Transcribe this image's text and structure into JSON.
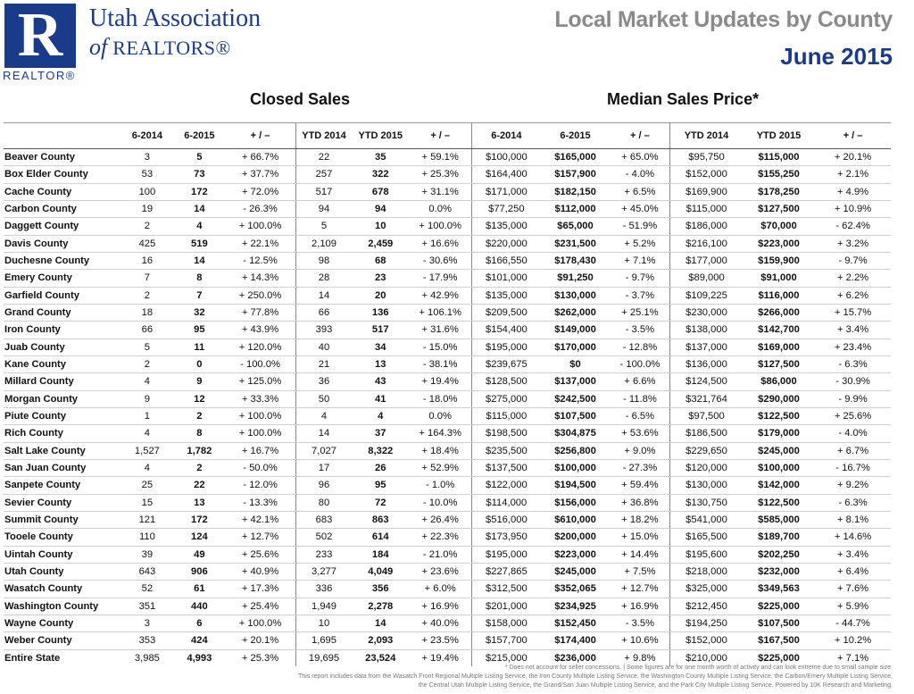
{
  "logo": {
    "letter": "R",
    "word": "REALTOR®"
  },
  "org": {
    "line1": "Utah Association",
    "of": "of",
    "line2": "REALTORS®"
  },
  "header": {
    "title": "Local Market Updates by County",
    "date": "June 2015"
  },
  "sections": {
    "closed": "Closed Sales",
    "median": "Median Sales Price*"
  },
  "columns": [
    "6-2014",
    "6-2015",
    "+ / –",
    "YTD 2014",
    "YTD 2015",
    "+ / –",
    "6-2014",
    "6-2015",
    "+ / –",
    "YTD 2014",
    "YTD 2015",
    "+ / –"
  ],
  "rows": [
    [
      "Beaver County",
      "3",
      "5",
      "+ 66.7%",
      "22",
      "35",
      "+ 59.1%",
      "$100,000",
      "$165,000",
      "+ 65.0%",
      "$95,750",
      "$115,000",
      "+ 20.1%"
    ],
    [
      "Box Elder County",
      "53",
      "73",
      "+ 37.7%",
      "257",
      "322",
      "+ 25.3%",
      "$164,400",
      "$157,900",
      "- 4.0%",
      "$152,000",
      "$155,250",
      "+ 2.1%"
    ],
    [
      "Cache County",
      "100",
      "172",
      "+ 72.0%",
      "517",
      "678",
      "+ 31.1%",
      "$171,000",
      "$182,150",
      "+ 6.5%",
      "$169,900",
      "$178,250",
      "+ 4.9%"
    ],
    [
      "Carbon County",
      "19",
      "14",
      "- 26.3%",
      "94",
      "94",
      "0.0%",
      "$77,250",
      "$112,000",
      "+ 45.0%",
      "$115,000",
      "$127,500",
      "+ 10.9%"
    ],
    [
      "Daggett County",
      "2",
      "4",
      "+ 100.0%",
      "5",
      "10",
      "+ 100.0%",
      "$135,000",
      "$65,000",
      "- 51.9%",
      "$186,000",
      "$70,000",
      "- 62.4%"
    ],
    [
      "Davis County",
      "425",
      "519",
      "+ 22.1%",
      "2,109",
      "2,459",
      "+ 16.6%",
      "$220,000",
      "$231,500",
      "+ 5.2%",
      "$216,100",
      "$223,000",
      "+ 3.2%"
    ],
    [
      "Duchesne County",
      "16",
      "14",
      "- 12.5%",
      "98",
      "68",
      "- 30.6%",
      "$166,550",
      "$178,430",
      "+ 7.1%",
      "$177,000",
      "$159,900",
      "- 9.7%"
    ],
    [
      "Emery County",
      "7",
      "8",
      "+ 14.3%",
      "28",
      "23",
      "- 17.9%",
      "$101,000",
      "$91,250",
      "- 9.7%",
      "$89,000",
      "$91,000",
      "+ 2.2%"
    ],
    [
      "Garfield County",
      "2",
      "7",
      "+ 250.0%",
      "14",
      "20",
      "+ 42.9%",
      "$135,000",
      "$130,000",
      "- 3.7%",
      "$109,225",
      "$116,000",
      "+ 6.2%"
    ],
    [
      "Grand County",
      "18",
      "32",
      "+ 77.8%",
      "66",
      "136",
      "+ 106.1%",
      "$209,500",
      "$262,000",
      "+ 25.1%",
      "$230,000",
      "$266,000",
      "+ 15.7%"
    ],
    [
      "Iron County",
      "66",
      "95",
      "+ 43.9%",
      "393",
      "517",
      "+ 31.6%",
      "$154,400",
      "$149,000",
      "- 3.5%",
      "$138,000",
      "$142,700",
      "+ 3.4%"
    ],
    [
      "Juab County",
      "5",
      "11",
      "+ 120.0%",
      "40",
      "34",
      "- 15.0%",
      "$195,000",
      "$170,000",
      "- 12.8%",
      "$137,000",
      "$169,000",
      "+ 23.4%"
    ],
    [
      "Kane County",
      "2",
      "0",
      "- 100.0%",
      "21",
      "13",
      "- 38.1%",
      "$239,675",
      "$0",
      "- 100.0%",
      "$136,000",
      "$127,500",
      "- 6.3%"
    ],
    [
      "Millard County",
      "4",
      "9",
      "+ 125.0%",
      "36",
      "43",
      "+ 19.4%",
      "$128,500",
      "$137,000",
      "+ 6.6%",
      "$124,500",
      "$86,000",
      "- 30.9%"
    ],
    [
      "Morgan County",
      "9",
      "12",
      "+ 33.3%",
      "50",
      "41",
      "- 18.0%",
      "$275,000",
      "$242,500",
      "- 11.8%",
      "$321,764",
      "$290,000",
      "- 9.9%"
    ],
    [
      "Piute County",
      "1",
      "2",
      "+ 100.0%",
      "4",
      "4",
      "0.0%",
      "$115,000",
      "$107,500",
      "- 6.5%",
      "$97,500",
      "$122,500",
      "+ 25.6%"
    ],
    [
      "Rich County",
      "4",
      "8",
      "+ 100.0%",
      "14",
      "37",
      "+ 164.3%",
      "$198,500",
      "$304,875",
      "+ 53.6%",
      "$186,500",
      "$179,000",
      "- 4.0%"
    ],
    [
      "Salt Lake County",
      "1,527",
      "1,782",
      "+ 16.7%",
      "7,027",
      "8,322",
      "+ 18.4%",
      "$235,500",
      "$256,800",
      "+ 9.0%",
      "$229,650",
      "$245,000",
      "+ 6.7%"
    ],
    [
      "San Juan County",
      "4",
      "2",
      "- 50.0%",
      "17",
      "26",
      "+ 52.9%",
      "$137,500",
      "$100,000",
      "- 27.3%",
      "$120,000",
      "$100,000",
      "- 16.7%"
    ],
    [
      "Sanpete County",
      "25",
      "22",
      "- 12.0%",
      "96",
      "95",
      "- 1.0%",
      "$122,000",
      "$194,500",
      "+ 59.4%",
      "$130,000",
      "$142,000",
      "+ 9.2%"
    ],
    [
      "Sevier County",
      "15",
      "13",
      "- 13.3%",
      "80",
      "72",
      "- 10.0%",
      "$114,000",
      "$156,000",
      "+ 36.8%",
      "$130,750",
      "$122,500",
      "- 6.3%"
    ],
    [
      "Summit County",
      "121",
      "172",
      "+ 42.1%",
      "683",
      "863",
      "+ 26.4%",
      "$516,000",
      "$610,000",
      "+ 18.2%",
      "$541,000",
      "$585,000",
      "+ 8.1%"
    ],
    [
      "Tooele County",
      "110",
      "124",
      "+ 12.7%",
      "502",
      "614",
      "+ 22.3%",
      "$173,950",
      "$200,000",
      "+ 15.0%",
      "$165,500",
      "$189,700",
      "+ 14.6%"
    ],
    [
      "Uintah County",
      "39",
      "49",
      "+ 25.6%",
      "233",
      "184",
      "- 21.0%",
      "$195,000",
      "$223,000",
      "+ 14.4%",
      "$195,600",
      "$202,250",
      "+ 3.4%"
    ],
    [
      "Utah County",
      "643",
      "906",
      "+ 40.9%",
      "3,277",
      "4,049",
      "+ 23.6%",
      "$227,865",
      "$245,000",
      "+ 7.5%",
      "$218,000",
      "$232,000",
      "+ 6.4%"
    ],
    [
      "Wasatch County",
      "52",
      "61",
      "+ 17.3%",
      "336",
      "356",
      "+ 6.0%",
      "$312,500",
      "$352,065",
      "+ 12.7%",
      "$325,000",
      "$349,563",
      "+ 7.6%"
    ],
    [
      "Washington County",
      "351",
      "440",
      "+ 25.4%",
      "1,949",
      "2,278",
      "+ 16.9%",
      "$201,000",
      "$234,925",
      "+ 16.9%",
      "$212,450",
      "$225,000",
      "+ 5.9%"
    ],
    [
      "Wayne County",
      "3",
      "6",
      "+ 100.0%",
      "10",
      "14",
      "+ 40.0%",
      "$158,000",
      "$152,450",
      "- 3.5%",
      "$194,250",
      "$107,500",
      "- 44.7%"
    ],
    [
      "Weber County",
      "353",
      "424",
      "+ 20.1%",
      "1,695",
      "2,093",
      "+ 23.5%",
      "$157,700",
      "$174,400",
      "+ 10.6%",
      "$152,000",
      "$167,500",
      "+ 10.2%"
    ]
  ],
  "total": [
    "Entire State",
    "3,985",
    "4,993",
    "+ 25.3%",
    "19,695",
    "23,524",
    "+ 19.4%",
    "$215,000",
    "$236,000",
    "+ 9.8%",
    "$210,000",
    "$225,000",
    "+ 7.1%"
  ],
  "footnote": {
    "line1": "* Does not account for seller concessions.  |  Some figures are for one month worth of activity and can look extreme due to small sample size.",
    "line2": "This report includes data from the Wasatch Front Regional Multiple Listing Service, the Iron County Multiple Listing Service, the Washington County Multiple Listing Service, the Carbon/Emery Multiple Listing Service,",
    "line3": "the Central Utah Multiple Listing Service, the Grand/San Juan Multiple Listing Service, and the Park City Multiple Listing Service. Powered by 10K Research and Marketing."
  }
}
